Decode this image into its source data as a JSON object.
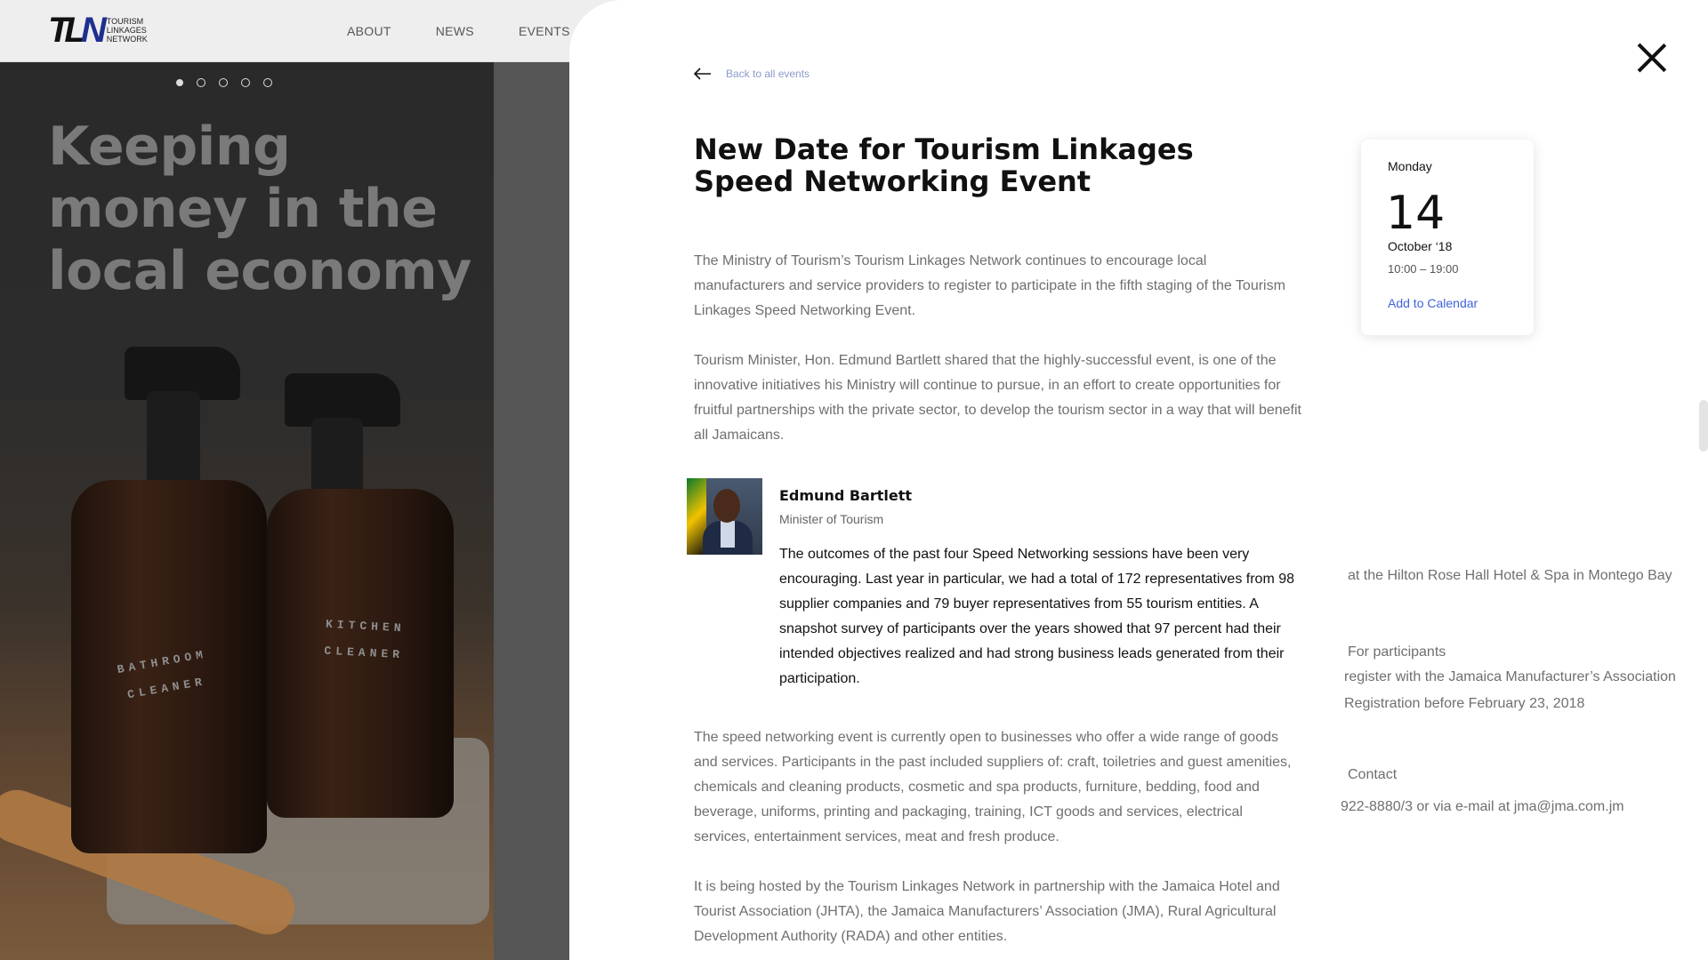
{
  "site": {
    "logo_mark_a": "TL",
    "logo_mark_b": "N",
    "logo_lines": [
      "TOURISM",
      "LINKAGES",
      "NETWORK"
    ],
    "nav": [
      "ABOUT",
      "NEWS",
      "EVENTS"
    ]
  },
  "hero": {
    "slider_dots": 5,
    "active_dot": 0,
    "headline": "Keeping money in the local economy",
    "bottle_labels": [
      "BATHROOM CLEANER",
      "KITCHEN CLEANER"
    ]
  },
  "drawer": {
    "back_label": "Back to all events",
    "title": "New Date for Tourism Linkages Speed Networking Event",
    "paragraphs": [
      "The Ministry of Tourism’s Tourism Linkages Network continues to encourage local manufacturers and service providers to register to participate in the fifth staging of the Tourism Linkages Speed Networking Event.",
      "Tourism Minister, Hon. Edmund Bartlett shared that the highly-successful event, is one of the innovative initiatives his Ministry will continue to pursue, in an effort to create opportunities for fruitful partnerships with the private sector, to develop the tourism sector in a way that will benefit all Jamaicans.",
      "The speed networking event is currently open to businesses who offer a wide range of goods and services. Participants in the past included suppliers of: craft, toiletries and guest amenities, chemicals and cleaning products, cosmetic and spa products, furniture, bedding, food and beverage, uniforms, printing and packaging, training, ICT goods and services, electrical services, entertainment services, meat and fresh produce.",
      "It is being hosted by the Tourism Linkages Network in partnership with the Jamaica Hotel and Tourist Association (JHTA), the Jamaica Manufacturers’ Association (JMA), Rural Agricultural Development Authority (RADA) and other entities."
    ],
    "quote": {
      "name": "Edmund Bartlett",
      "role": "Minister of Tourism",
      "text": "The outcomes of the past four Speed Networking sessions have been very encouraging. Last year in particular, we had a total of 172 representatives from 98 supplier companies and 79 buyer representatives from 55 tourism entities. A snapshot survey of participants over the years showed that 97 percent had their intended objectives realized and had strong business leads generated from their participation."
    },
    "date_card": {
      "weekday": "Monday",
      "day": "14",
      "month_year": "October ‘18",
      "time": "10:00 – 19:00",
      "add_to_calendar": "Add to Calendar"
    },
    "side": {
      "venue": "at the Hilton Rose Hall Hotel & Spa in Montego Bay",
      "participants_heading": "For participants",
      "participants_line1": "register with the Jamaica Manufacturer’s Association",
      "participants_line2": "Registration before February 23, 2018",
      "contact_heading": "Contact",
      "contact_text": "922-8880/3 or via e-mail at jma@jma.com.jm"
    }
  }
}
